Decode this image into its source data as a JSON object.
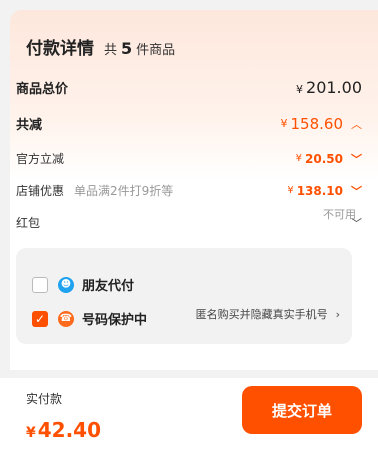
{
  "header": {
    "title": "付款详情",
    "count_prefix": "共",
    "count": "5",
    "count_suffix": "件商品"
  },
  "rows": {
    "total": {
      "label": "商品总价",
      "currency": "¥",
      "value": "201.00"
    },
    "discount": {
      "label": "共减",
      "currency": "¥",
      "value": "158.60"
    },
    "official": {
      "label": "官方立减",
      "currency": "¥",
      "value": "20.50"
    },
    "store": {
      "label": "店铺优惠",
      "note": "单品满2件打9折等",
      "currency": "¥",
      "value": "138.10"
    },
    "redpacket": {
      "label": "红包",
      "status": "不可用"
    }
  },
  "options": {
    "friend_pay": {
      "label": "朋友代付",
      "checked": false
    },
    "number_protect": {
      "label": "号码保护中",
      "checked": true,
      "note": "匿名购买并隐藏真实手机号"
    }
  },
  "footer": {
    "pay_label": "实付款",
    "currency": "¥",
    "amount": "42.40",
    "submit_label": "提交订单"
  },
  "colors": {
    "accent": "#ff5000",
    "blue_icon": "#1fa2ef"
  },
  "icons": {
    "friend_pay": "person-badge-icon",
    "number_protect": "shield-phone-icon"
  }
}
